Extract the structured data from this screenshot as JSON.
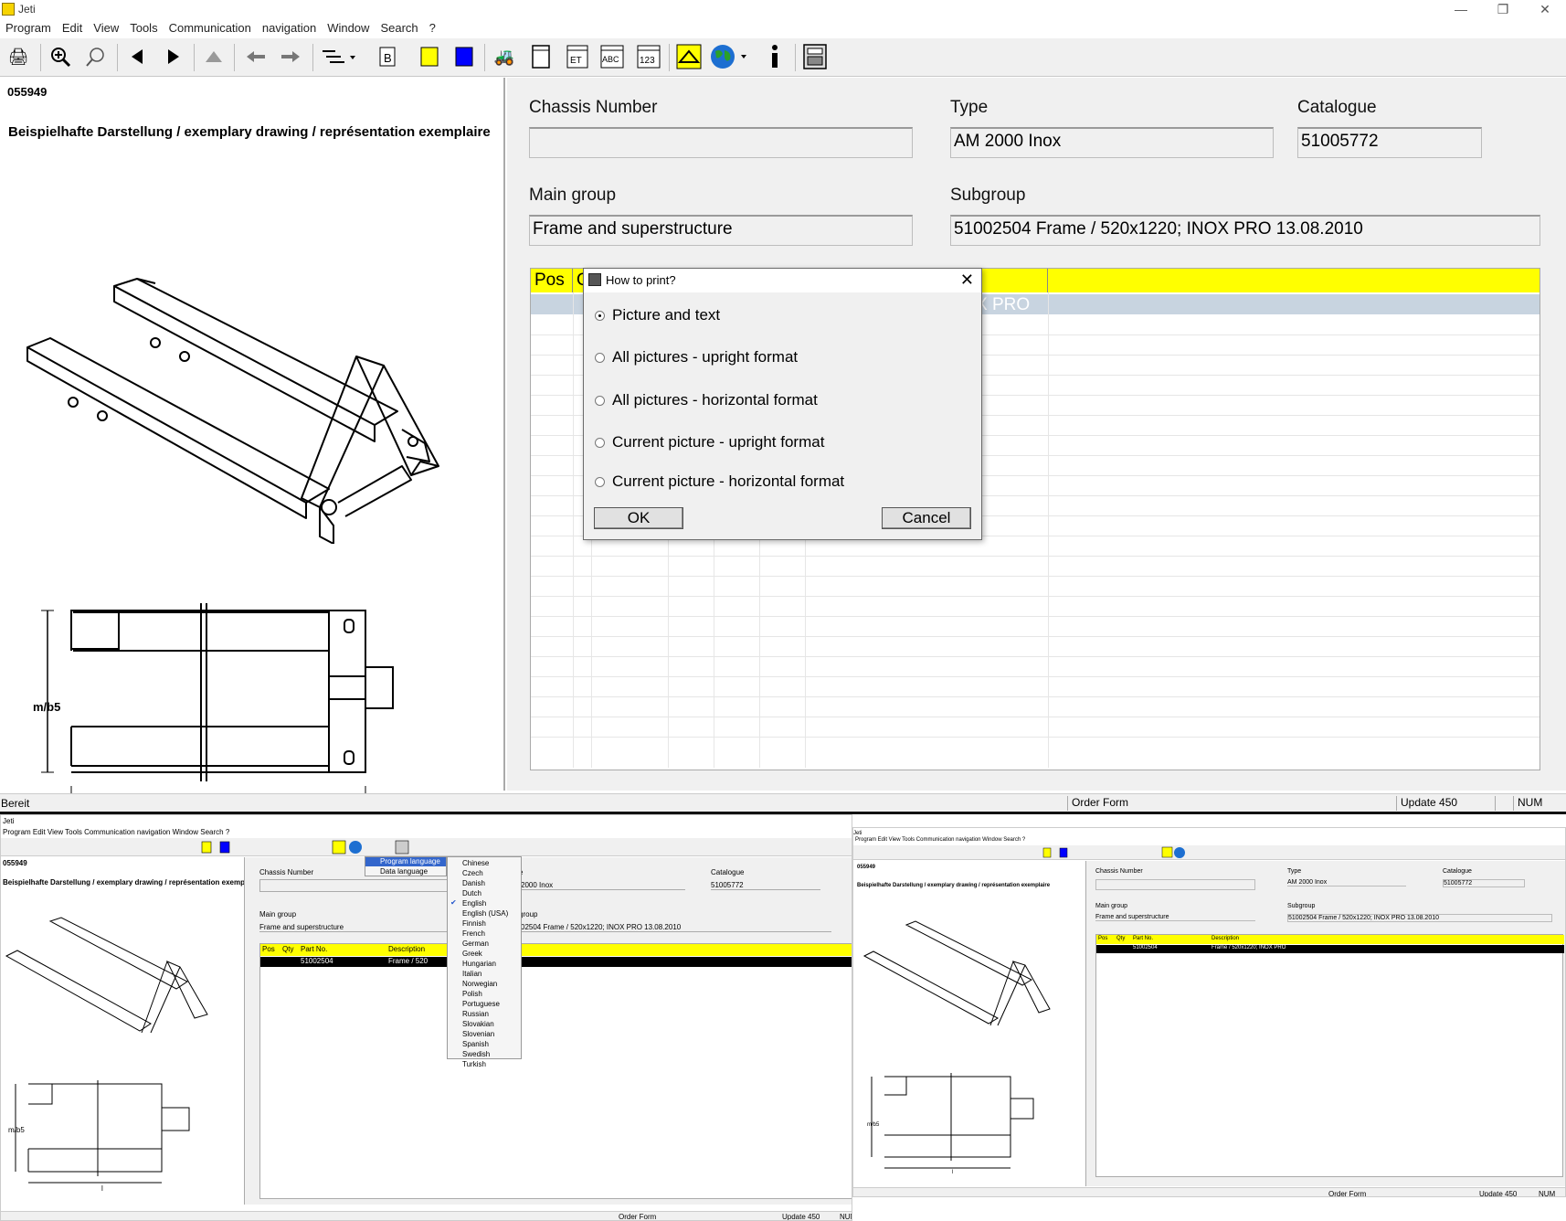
{
  "window": {
    "title": "Jeti",
    "min": "—",
    "restore": "❐",
    "close": "✕"
  },
  "menu": [
    "Program",
    "Edit",
    "View",
    "Tools",
    "Communication",
    "navigation",
    "Window",
    "Search",
    "?"
  ],
  "left": {
    "drawing_no": "055949",
    "caption": "Beispielhafte Darstellung / exemplary drawing / représentation exemplaire",
    "dim_label": "m/b5",
    "length_label": "l"
  },
  "form": {
    "chassis_label": "Chassis Number",
    "chassis_value": "",
    "type_label": "Type",
    "type_value": "AM 2000 Inox",
    "catalogue_label": "Catalogue",
    "catalogue_value": "51005772",
    "maingroup_label": "Main group",
    "maingroup_value": "Frame and superstructure",
    "subgroup_label": "Subgroup",
    "subgroup_value": "51002504  Frame / 520x1220; INOX PRO 13.08.2010"
  },
  "grid": {
    "col_pos": "Pos",
    "col_qty_partial": "Q",
    "row1_tail": "X PRO"
  },
  "dialog": {
    "title": "How to print?",
    "options": [
      "Picture and text",
      "All pictures - upright format",
      "All pictures - horizontal  format",
      "Current picture - upright format",
      "Current picture - horizontal format"
    ],
    "ok": "OK",
    "cancel": "Cancel"
  },
  "status": {
    "ready": "Bereit",
    "order_form": "Order Form",
    "update": "Update 450",
    "num": "NUM"
  },
  "mini1": {
    "title": "Jeti",
    "menu": "Program  Edit  View  Tools  Communication  navigation  Window  Search  ?",
    "drawing_no": "055949",
    "caption": "Beispielhafte Darstellung / exemplary drawing / représentation exemplaire",
    "chassis_label": "Chassis Number",
    "type_label": "e",
    "type_value": "2000 Inox",
    "catalogue_label": "Catalogue",
    "catalogue_value": "51005772",
    "maingroup_label": "Main group",
    "maingroup_value": "Frame and superstructure",
    "subgroup_label": "group",
    "subgroup_value": "02504  Frame / 520x1220; INOX PRO 13.08.2010",
    "cols": [
      "Pos",
      "Qty",
      "Part No.",
      "Description"
    ],
    "row_part": "51002504",
    "row_desc": "Frame / 520",
    "menu_program_language": "Program language",
    "menu_data_language": "Data language",
    "languages": [
      "Chinese",
      "Czech",
      "Danish",
      "Dutch",
      "English",
      "English (USA)",
      "Finnish",
      "French",
      "German",
      "Greek",
      "Hungarian",
      "Italian",
      "Norwegian",
      "Polish",
      "Portuguese",
      "Russian",
      "Slovakian",
      "Slovenian",
      "Spanish",
      "Swedish",
      "Turkish"
    ],
    "dim_label": "m/b5",
    "length_label": "l",
    "status_order": "Order Form",
    "status_update": "Update 450",
    "status_num": "NUM"
  },
  "mini2": {
    "title": "Jeti",
    "menu": "Program  Edit  View  Tools  Communication  navigation  Window  Search  ?",
    "drawing_no": "055949",
    "caption": "Beispielhafte Darstellung / exemplary drawing / représentation exemplaire",
    "chassis_label": "Chassis Number",
    "type_label": "Type",
    "type_value": "AM 2000 Inox",
    "catalogue_label": "Catalogue",
    "catalogue_value": "51005772",
    "maingroup_label": "Main group",
    "maingroup_value": "Frame and superstructure",
    "subgroup_label": "Subgroup",
    "subgroup_value": "51002504  Frame / 520x1220; INOX PRO 13.08.2010",
    "cols": [
      "Pos",
      "Qty",
      "Part No.",
      "Description"
    ],
    "row_part": "51002504",
    "row_desc": "Frame / 520x1220; INOX PRO",
    "dim_label": "m/b5",
    "length_label": "l",
    "status_order": "Order Form",
    "status_update": "Update 450",
    "status_num": "NUM"
  },
  "colors": {
    "header_yellow": "#ffff00",
    "selected_row": "#c8d4e0",
    "toolbar_blue": "#0000ff"
  }
}
